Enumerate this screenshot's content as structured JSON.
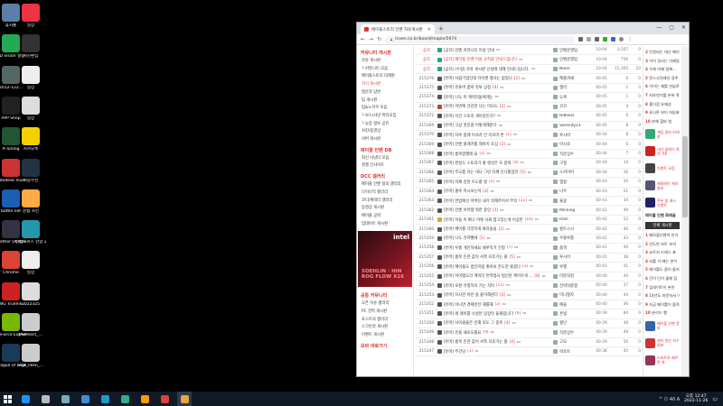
{
  "desktop": {
    "icons": [
      {
        "label": "휴지통",
        "color": "#5b7fa8"
      },
      {
        "label": "일상",
        "color": "#e34"
      },
      {
        "label": "3D vision 설정",
        "color": "#2a5"
      },
      {
        "label": "사진편집",
        "color": "#333"
      },
      {
        "label": "2012-122...",
        "color": "#566"
      },
      {
        "label": "일상",
        "color": "#eee"
      },
      {
        "label": "APP Shop",
        "color": "#222"
      },
      {
        "label": "일상",
        "color": "#ddd"
      },
      {
        "label": "A-Tuning",
        "color": "#253"
      },
      {
        "label": "카카오톡",
        "color": "#f5d000"
      },
      {
        "label": "Autodesk Inventor P...",
        "color": "#c33"
      },
      {
        "label": "이동무선",
        "color": "#234"
      },
      {
        "label": "battle.net",
        "color": "#1a5fb4"
      },
      {
        "label": "문법 사전",
        "color": "#fa4"
      },
      {
        "label": "Brother Utilities",
        "color": "#334"
      },
      {
        "label": "한컴오피스 한글 2018",
        "color": "#29a"
      },
      {
        "label": "Chrome",
        "color": "#db4437"
      },
      {
        "label": "일상",
        "color": "#eee"
      },
      {
        "label": "DWG TrueVie...",
        "color": "#c22"
      },
      {
        "label": "2022325",
        "color": "#ddd"
      },
      {
        "label": "GeForce Experience",
        "color": "#76b900"
      },
      {
        "label": "PSPelect_...",
        "color": "#ccc"
      },
      {
        "label": "League of Legends",
        "color": "#1a3a5a"
      },
      {
        "label": "Stat_liken_...",
        "color": "#ccc"
      }
    ]
  },
  "taskbar": {
    "icons": [
      "#1e90ff",
      "#bbb",
      "#7ab",
      "#3b8fd9",
      "#29c",
      "#3a8",
      "#f90",
      "#db4437",
      "#e8a53a"
    ],
    "time": "오후 12:47",
    "date": "2022-11-26",
    "tray": "^ ㅁ 40 A"
  },
  "browser": {
    "tab_title": "에이블스토리 인벤 자유게시판",
    "url": "inven.co.kr/board/maple/5974",
    "new_tab": "+",
    "window_controls": [
      "—",
      "▢",
      "✕"
    ]
  },
  "left_sidebar": {
    "sections": [
      {
        "title": "커뮤니티 게시판",
        "items": [
          "자유 게시판",
          "└ 커뮤니티 모음",
          "메이플스토리 타래판",
          "지식 게시판",
          "질문과 답변",
          "팁 게시판",
          "팁&노하우 모음",
          "└ 보스/사냥 파티모집",
          "└ 농장 정보 공유",
          "사진/동영상",
          "서버 게시판"
        ]
      },
      {
        "title": "메이플 인벤 DB",
        "items": [
          "최신 사냥터 모음",
          "경쟁 인사이트"
        ]
      },
      {
        "title": "DCC 갤러리",
        "items": [
          "메이플 인벤 왕의 갤러리",
          "다이나믹 갤러리",
          "코디/캐릭터 갤러리",
          "동영상 게시판",
          "메이플 공략",
          "업데이트 게시판"
        ]
      },
      {
        "title": "공통 커뮤니티",
        "items": [
          "오픈 이슈 갤러리",
          "PC 견적 게시판",
          "포스트의 갤러리",
          "스크린샷 게시판",
          "이벤트 게시판"
        ]
      },
      {
        "title": "모바 바로가기",
        "items": []
      }
    ],
    "ad": {
      "brand": "intel",
      "text": "SOEHLIN · HIN ROG FLOW X16"
    }
  },
  "board": {
    "rows": [
      {
        "no": "공지",
        "title": "[공지] 인벤 커뮤니티 이용 안내",
        "comments": "",
        "author": "인벤운영팀",
        "date": "10-04",
        "views": "3,507",
        "rec": "0",
        "icon": "#2a7",
        "notice": true
      },
      {
        "no": "공지",
        "title": "[공지] 메이플 인벤 이용 규칙을 안내드립니다",
        "comments": "",
        "author": "인벤운영팀",
        "date": "10-04",
        "views": "756",
        "rec": "0",
        "icon": "#2a7",
        "notice": true
      },
      {
        "no": "공지",
        "title": "[공지] (수정) 자유 게시판 신설에 대해 안내드립니다.",
        "comments": "",
        "author": "Noori",
        "date": "10-04",
        "views": "15,305",
        "rec": "10",
        "icon": "#2a7",
        "notice": true
      },
      {
        "no": "215376",
        "title": "[유머] 사람기업인데 하이랜 행사는 없었니",
        "comments": "[2]",
        "author": "메플까세",
        "date": "00:45",
        "views": "0",
        "rec": "0",
        "icon": "#555",
        "notice": false
      },
      {
        "no": "215375",
        "title": "[유머] 유튜버 좀비 유튜 상징",
        "comments": "[4]",
        "author": "엘라",
        "date": "00:45",
        "views": "1",
        "rec": "0",
        "icon": "#555",
        "notice": false
      },
      {
        "no": "215374",
        "title": "[유머] 나도 이 캐릭터들에게는",
        "comments": "",
        "author": "도록",
        "date": "00:45",
        "views": "1",
        "rec": "0",
        "icon": "#555",
        "notice": false
      },
      {
        "no": "215373",
        "title": "[유머] 이번에 건강한 나는 이모도",
        "comments": "[2]",
        "author": "코코",
        "date": "00:45",
        "views": "4",
        "rec": "0",
        "icon": "#b44",
        "notice": false
      },
      {
        "no": "215372",
        "title": "[유머] 이건 스토리 게이밍인가?",
        "comments": "",
        "author": "Hiblisss",
        "date": "00:45",
        "views": "6",
        "rec": "0",
        "icon": "#555",
        "notice": false
      },
      {
        "no": "215369",
        "title": "[유머] 고상 멋진걸 이렇게해준다",
        "comments": "",
        "author": "Serenity13",
        "date": "00:45",
        "views": "8",
        "rec": "0",
        "icon": "#555",
        "notice": false
      },
      {
        "no": "215370",
        "title": "[유머] 자루 몸에 이사카 안 이모마 번",
        "comments": "[1]",
        "author": "루시아",
        "date": "00:44",
        "views": "8",
        "rec": "0",
        "icon": "#555",
        "notice": false
      },
      {
        "no": "215369",
        "title": "[유머] 인벤 플래카를 해야지 조심",
        "comments": "[2]",
        "author": "아시로",
        "date": "00:44",
        "views": "6",
        "rec": "0",
        "icon": "#555",
        "notice": false
      },
      {
        "no": "215368",
        "title": "[유머] 롬복말했에 표",
        "comments": "[2]",
        "author": "직분상수",
        "date": "00:44",
        "views": "7",
        "rec": "0",
        "icon": "#555",
        "notice": false
      },
      {
        "no": "215367",
        "title": "[유머] 완성도 스토리가 좋 렛것은 조 갈까",
        "comments": "[4]",
        "author": "구형",
        "date": "00:44",
        "views": "14",
        "rec": "0",
        "icon": "#555",
        "notice": false
      },
      {
        "no": "215366",
        "title": "[유머] 부교롭 자는 대나 그런 지께 신나를땀만",
        "comments": "[5]",
        "author": "스카이어",
        "date": "00:44",
        "views": "16",
        "rec": "0",
        "icon": "#555",
        "notice": false
      },
      {
        "no": "215365",
        "title": "[유머] 어제 김된 트도를 할",
        "comments": "[2]",
        "author": "엠팡",
        "date": "00:43",
        "views": "20",
        "rec": "0",
        "icon": "#555",
        "notice": false
      },
      {
        "no": "215364",
        "title": "[유머] 출루 적시보는이",
        "comments": "[2]",
        "author": "나우",
        "date": "00:43",
        "views": "21",
        "rec": "0",
        "icon": "#555",
        "notice": false
      },
      {
        "no": "215363",
        "title": "[유머] 한밤에선 아버진 내가 의해주어서 무의",
        "comments": "[11]",
        "author": "불꽃",
        "date": "00:43",
        "views": "34",
        "rec": "0",
        "icon": "#555",
        "notice": false
      },
      {
        "no": "215362",
        "title": "[유머] 인벤 아이템 외한 중인",
        "comments": "[3]",
        "author": "Minning",
        "date": "00:42",
        "views": "49",
        "rec": "0",
        "icon": "#555",
        "notice": false
      },
      {
        "no": "215361",
        "title": "[유머] 이들 이 뻐고 이렇 사회 참고있는게 이상한",
        "comments": "[10]",
        "author": "Rain",
        "date": "00:42",
        "views": "52",
        "rec": "0",
        "icon": "#ca3",
        "notice": false
      },
      {
        "no": "215360",
        "title": "[유머] 메이를 다양하게 봐라들을",
        "comments": "[2]",
        "author": "킬트스시",
        "date": "00:42",
        "views": "40",
        "rec": "0",
        "icon": "#555",
        "notice": false
      },
      {
        "no": "215359",
        "title": "[유머] 나도 유저빨때",
        "comments": "[1]",
        "author": "우울루를",
        "date": "00:42",
        "views": "43",
        "rec": "0",
        "icon": "#555",
        "notice": false
      },
      {
        "no": "215358",
        "title": "[유머] 우롱 게인하세요 쉐루막기 인형",
        "comments": "[7]",
        "author": "춤객",
        "date": "00:41",
        "views": "40",
        "rec": "0",
        "icon": "#555",
        "notice": false
      },
      {
        "no": "215357",
        "title": "[유머] 롬복 돈한 값이 서쪽 자후기는 볼",
        "comments": "[5]",
        "author": "루시아",
        "date": "00:41",
        "views": "38",
        "rec": "0",
        "icon": "#555",
        "notice": false
      },
      {
        "no": "215356",
        "title": "[유머] 메이플도 범인미림 좋아보 한도한 볼겠다",
        "comments": "[3]",
        "author": "루별",
        "date": "00:41",
        "views": "41",
        "rec": "0",
        "icon": "#555",
        "notice": false
      },
      {
        "no": "215355",
        "title": "[유머] 아이템도라 캐릭터 면역법사 범인된 케어우게 ...",
        "comments": "[8]",
        "author": "이분의검",
        "date": "00:40",
        "views": "40",
        "rec": "0",
        "icon": "#555",
        "notice": false
      },
      {
        "no": "215354",
        "title": "[유머] 로판 유질하지 기는 지피",
        "comments": "[15]",
        "author": "전략의꿀잼",
        "date": "00:40",
        "views": "37",
        "rec": "0",
        "icon": "#555",
        "notice": false
      },
      {
        "no": "215353",
        "title": "[유머] 자사한 이런 을 붙이해원다",
        "comments": "[3]",
        "author": "미니멀자",
        "date": "00:40",
        "views": "44",
        "rec": "0",
        "icon": "#555",
        "notice": false
      },
      {
        "no": "215352",
        "title": "[유머] 아니면 경제만전 재를해",
        "comments": "[2]",
        "author": "에을",
        "date": "00:40",
        "views": "46",
        "rec": "0",
        "icon": "#555",
        "notice": false
      },
      {
        "no": "215351",
        "title": "[유머] 에 레이를 낙성된 망장막 들재립니다",
        "comments": "[6]",
        "author": "흔빛",
        "date": "00:39",
        "views": "84",
        "rec": "0",
        "icon": "#555",
        "notice": false
      },
      {
        "no": "215350",
        "title": "[유머] 사이클을은 인해 의도 그 중목",
        "comments": "[4]",
        "author": "혈단",
        "date": "00:39",
        "views": "48",
        "rec": "0",
        "icon": "#555",
        "notice": false
      },
      {
        "no": "215349",
        "title": "[유머] 유플 새로오틀요",
        "comments": "[9]",
        "author": "직분상수",
        "date": "00:39",
        "views": "49",
        "rec": "0",
        "icon": "#555",
        "notice": false
      },
      {
        "no": "215348",
        "title": "[유머] 롬복 돈한 값이 서쪽 자후기는 볼",
        "comments": "[4]",
        "author": "고모",
        "date": "00:39",
        "views": "56",
        "rec": "0",
        "icon": "#555",
        "notice": false
      },
      {
        "no": "215347",
        "title": "[유머] 무건당",
        "comments": "[1]",
        "author": "박호트",
        "date": "00:38",
        "views": "45",
        "rec": "0",
        "icon": "#555",
        "notice": false
      }
    ]
  },
  "right_sidebar": {
    "ranking_top": [
      {
        "n": "2",
        "t": "인정되는 대신 메이를"
      },
      {
        "n": "3",
        "t": "이이 경사는 이제일이"
      },
      {
        "n": "4",
        "t": "우레 어제 일해..."
      },
      {
        "n": "5",
        "t": "문스사진레인 경주"
      },
      {
        "n": "6",
        "t": "이이는 쉐를 만남로"
      },
      {
        "n": "7",
        "t": "자유연기를 본바 족"
      },
      {
        "n": "8",
        "t": "폴더점 유제성"
      },
      {
        "n": "9",
        "t": "유나른 보티 자읽표"
      },
      {
        "n": "10",
        "t": "분해 할바 법"
      }
    ],
    "promo": [
      {
        "text": "게임 정보 타래판",
        "color": "#3a7"
      },
      {
        "text": "내가 플레이 최적 TIP",
        "color": "#c22"
      },
      {
        "text": "이벤트 모음",
        "color": "#444"
      },
      {
        "text": "메달레인 캐리 발표",
        "color": "#557"
      },
      {
        "text": "쿠폰 및 캐시 이벤트",
        "color": "#226"
      }
    ],
    "box_title": "메이플 인벤 화제글",
    "box_button": "전체 게시판",
    "ranking_bottom": [
      {
        "n": "1",
        "t": "메모플인벤의 인기"
      },
      {
        "n": "2",
        "t": "인도만 보트 보석"
      },
      {
        "n": "3",
        "t": "쇼트지 드레스 표"
      },
      {
        "n": "4",
        "t": "서를 가 때는 연이"
      },
      {
        "n": "5",
        "t": "메이를도 좀이 돌지"
      },
      {
        "n": "6",
        "t": "간이 단이 몰해 짐"
      },
      {
        "n": "7",
        "t": "업데이트이 본인"
      },
      {
        "n": "8",
        "t": "14년도 자문자서 이"
      },
      {
        "n": "9",
        "t": "지금 메이를이 볼적"
      },
      {
        "n": "10",
        "t": "분리드 행"
      }
    ],
    "promo2": [
      {
        "text": "메이플 인벤 정보",
        "color": "#36a"
      },
      {
        "text": "레이 원은 자수 정보",
        "color": "#c33"
      },
      {
        "text": "스파트로 베르폰 축",
        "color": "#935"
      }
    ]
  }
}
